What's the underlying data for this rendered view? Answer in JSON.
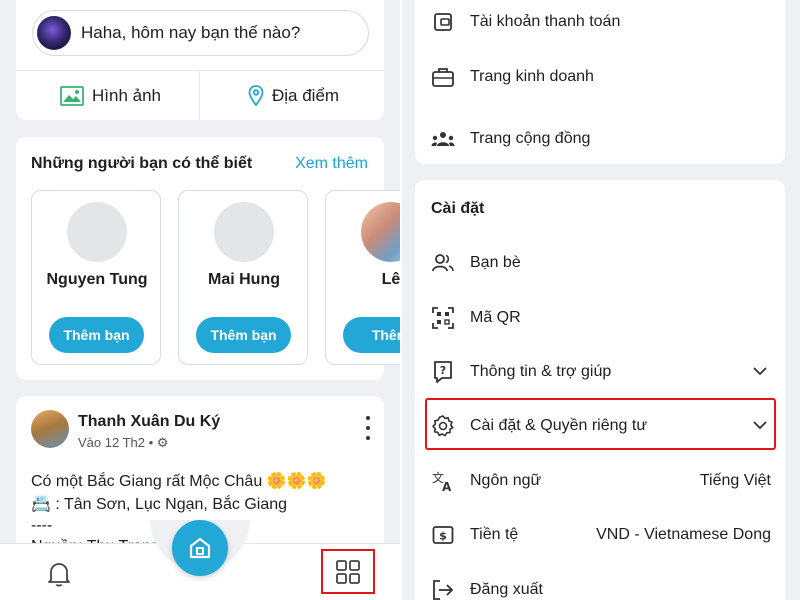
{
  "left_screen": {
    "composer": {
      "status_placeholder": "Haha, hôm nay bạn thế nào?",
      "photo_label": "Hình ảnh",
      "place_label": "Địa điểm"
    },
    "suggestions": {
      "title": "Những người bạn có thể biết",
      "see_more": "Xem thêm",
      "friends": [
        {
          "name": "Nguyen Tung",
          "button": "Thêm bạn"
        },
        {
          "name": "Mai Hung",
          "button": "Thêm bạn"
        },
        {
          "name": "Lê",
          "button": "Thêm"
        }
      ]
    },
    "post": {
      "author": "Thanh Xuân Du Ký",
      "meta": "Vào 12 Th2 • ⚙",
      "line1": "Có một Bắc Giang rất Mộc Châu 🌼🌼🌼",
      "line2": "📇 : Tân Sơn, Lục Ngạn, Bắc Giang",
      "line3": "----",
      "line4": "Nguồn: Thu Trang"
    },
    "bottom_nav": {
      "notifications_icon": "bell-icon",
      "home_icon": "home-icon",
      "menu_icon": "grid-icon"
    }
  },
  "right_screen": {
    "top_items": [
      {
        "label": "Tài khoản thanh toán",
        "icon": "wallet-icon"
      },
      {
        "label": "Trang kinh doanh",
        "icon": "briefcase-icon"
      },
      {
        "label": "Trang cộng đồng",
        "icon": "community-icon"
      }
    ],
    "settings": {
      "title": "Cài đặt",
      "items": [
        {
          "label": "Bạn bè",
          "icon": "friends-icon"
        },
        {
          "label": "Mã QR",
          "icon": "qr-icon"
        },
        {
          "label": "Thông tin & trợ giúp",
          "icon": "help-icon"
        },
        {
          "label": "Cài đặt & Quyền riêng tư",
          "icon": "gear-icon"
        },
        {
          "label": "Ngôn ngữ",
          "icon": "translate-icon",
          "value": "Tiếng Việt"
        },
        {
          "label": "Tiền tệ",
          "icon": "currency-icon",
          "value": "VND - Vietnamese Dong"
        },
        {
          "label": "Đăng xuất",
          "icon": "logout-icon"
        }
      ]
    }
  },
  "colors": {
    "accent": "#22a7d6",
    "link": "#1aa3d9",
    "highlight": "#e0161b",
    "background": "#eef0f4"
  }
}
